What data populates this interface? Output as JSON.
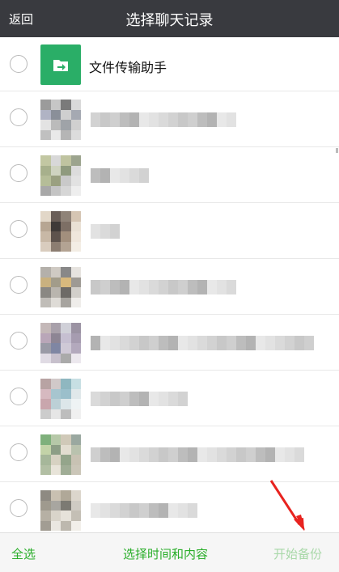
{
  "header": {
    "back_label": "返回",
    "title": "选择聊天记录"
  },
  "first_chat": {
    "name": "文件传输助手",
    "icon": "folder-arrow-icon",
    "icon_color": "#2aae67"
  },
  "blurred_chats_note": "remaining chat names and avatars are pixelated/obscured",
  "footer": {
    "select_all_label": "全选",
    "time_range_label": "选择时间和内容",
    "start_backup_label": "开始备份"
  },
  "colors": {
    "header_bg": "#393a3f",
    "accent_green": "#2aae2a",
    "disabled_green": "#a8d8a8",
    "annotation_arrow": "#e8231f"
  }
}
